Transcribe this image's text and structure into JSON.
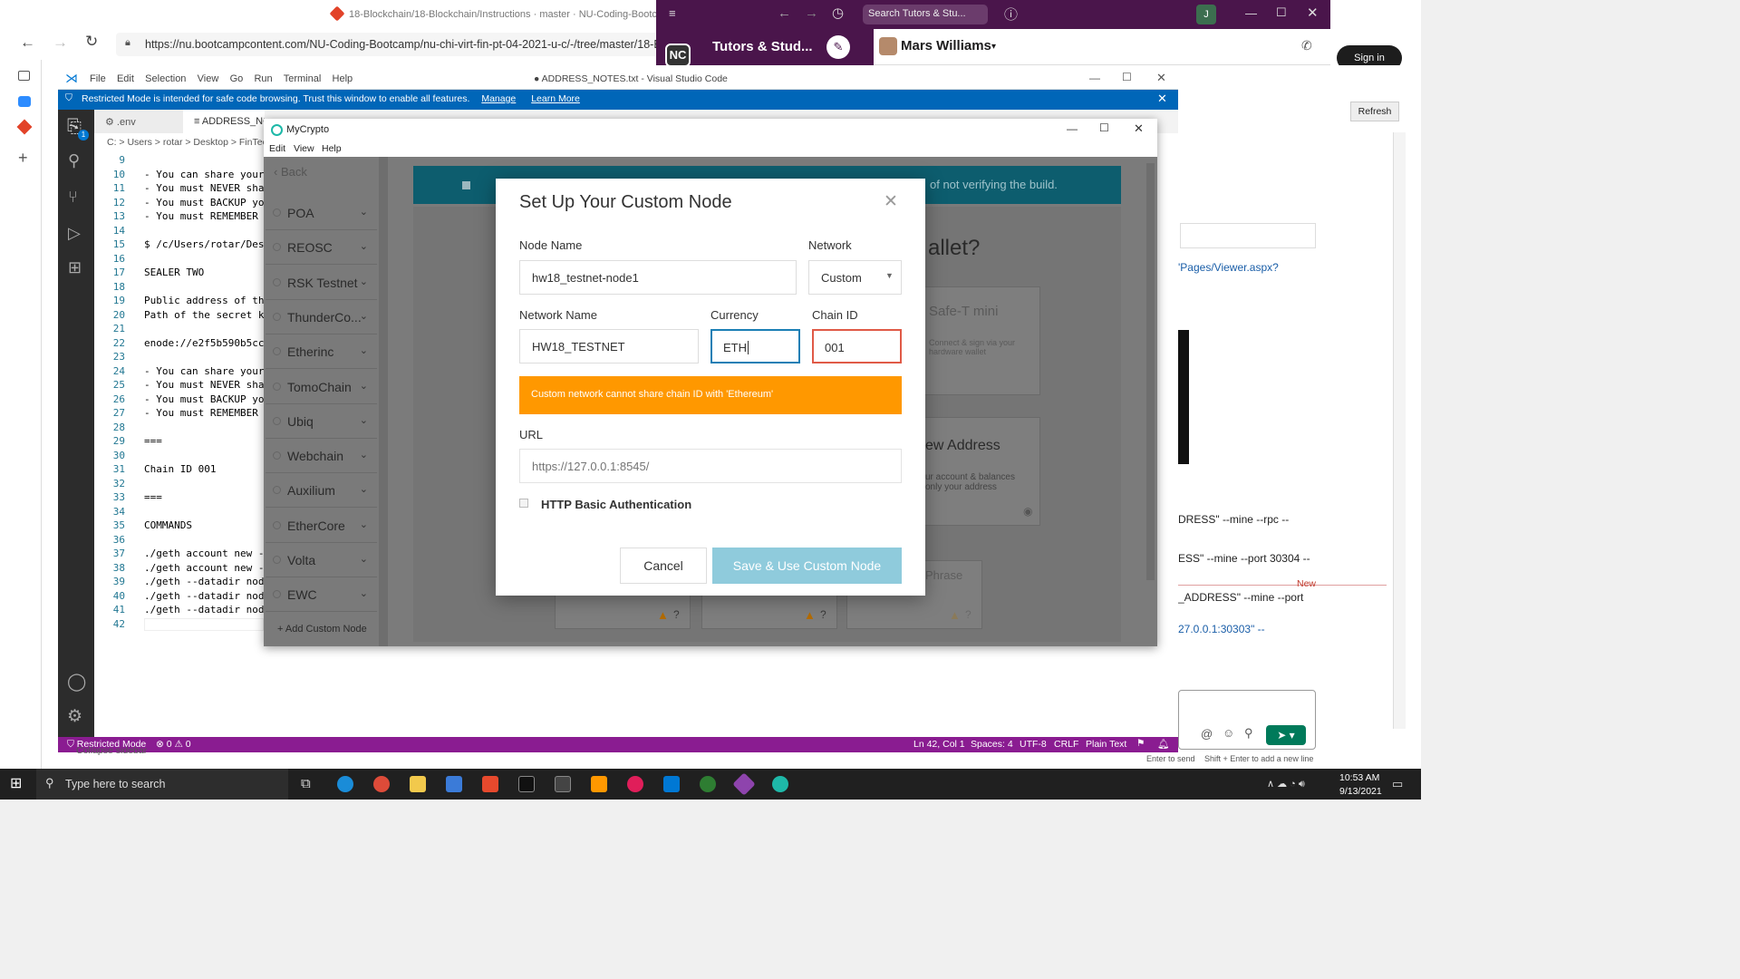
{
  "browser": {
    "tab_title": "18-Blockchain/18-Blockchain/Instructions · master · NU-Coding-Bootcamp / N",
    "url": "https://nu.bootcampcontent.com/NU-Coding-Bootcamp/nu-chi-virt-fin-pt-04-2021-u-c/-/tree/master/18-Block"
  },
  "slack": {
    "search_placeholder": "Search Tutors & Stu...",
    "workspace_initials": "NC",
    "workspace_name": "Tutors & Stud...",
    "user_name": "Mars Williams",
    "signin_label": "Sign in",
    "refresh_label": "Refresh",
    "fragments": {
      "viewer": "'Pages/Viewer.aspx?",
      "mine_rpc": "DRESS\" --mine --rpc --",
      "mine_port": "ESS\" --mine --port 30304 --",
      "new_label": "New",
      "address_mine": "_ADDRESS\" --mine --port",
      "enode_port": "27.0.0.1:30303\" --",
      "enter_hint": "Enter to send",
      "shift_hint": "Shift + Enter to add a new line"
    }
  },
  "vscode": {
    "menu": [
      "File",
      "Edit",
      "Selection",
      "View",
      "Go",
      "Run",
      "Terminal",
      "Help"
    ],
    "window_title": "● ADDRESS_NOTES.txt - Visual Studio Code",
    "banner_text": "Restricted Mode is intended for safe code browsing. Trust this window to enable all features.",
    "banner_manage": "Manage",
    "banner_learn": "Learn More",
    "tabs": [
      ".env",
      "ADDRESS_NO"
    ],
    "breadcrumb": "C: > Users > rotar > Desktop > FinTec",
    "explorer_badge": "1",
    "collapse_sidebar": "Collapse sidebar",
    "lines": [
      {
        "n": "9",
        "t": ""
      },
      {
        "n": "10",
        "t": "- You can share your"
      },
      {
        "n": "11",
        "t": "- You must NEVER shar"
      },
      {
        "n": "12",
        "t": "- You must BACKUP you"
      },
      {
        "n": "13",
        "t": "- You must REMEMBER y"
      },
      {
        "n": "14",
        "t": ""
      },
      {
        "n": "15",
        "t": "$ /c/Users/rotar/Desk"
      },
      {
        "n": "16",
        "t": ""
      },
      {
        "n": "17",
        "t": "SEALER TWO"
      },
      {
        "n": "18",
        "t": ""
      },
      {
        "n": "19",
        "t": "Public address of the"
      },
      {
        "n": "20",
        "t": "Path of the secret ke"
      },
      {
        "n": "21",
        "t": ""
      },
      {
        "n": "22",
        "t": "enode://e2f5b590b5cce"
      },
      {
        "n": "23",
        "t": ""
      },
      {
        "n": "24",
        "t": "- You can share your"
      },
      {
        "n": "25",
        "t": "- You must NEVER shar"
      },
      {
        "n": "26",
        "t": "- You must BACKUP you"
      },
      {
        "n": "27",
        "t": "- You must REMEMBER y"
      },
      {
        "n": "28",
        "t": ""
      },
      {
        "n": "29",
        "t": "==="
      },
      {
        "n": "30",
        "t": ""
      },
      {
        "n": "31",
        "t": "Chain ID 001"
      },
      {
        "n": "32",
        "t": ""
      },
      {
        "n": "33",
        "t": "==="
      },
      {
        "n": "34",
        "t": ""
      },
      {
        "n": "35",
        "t": "COMMANDS"
      },
      {
        "n": "36",
        "t": ""
      },
      {
        "n": "37",
        "t": "./geth account new --"
      },
      {
        "n": "38",
        "t": "./geth account new --"
      },
      {
        "n": "39",
        "t": "./geth --datadir node"
      },
      {
        "n": "40",
        "t": "./geth --datadir node"
      },
      {
        "n": "41",
        "t": "./geth --datadir node"
      },
      {
        "n": "42",
        "t": ""
      }
    ],
    "status": {
      "mode": "Restricted Mode",
      "problems": "⊗ 0 ⚠ 0",
      "position": "Ln 42, Col 1",
      "spaces": "Spaces: 4",
      "encoding": "UTF-8",
      "eol": "CRLF",
      "language": "Plain Text"
    }
  },
  "mycrypto": {
    "title": "MyCrypto",
    "menu": [
      "Edit",
      "View",
      "Help"
    ],
    "back_label": "Back",
    "networks": [
      "POA",
      "REOSC",
      "RSK Testnet",
      "ThunderCo...",
      "Etherinc",
      "TomoChain",
      "Ubiq",
      "Webchain",
      "Auxilium",
      "EtherCore",
      "Volta",
      "EWC"
    ],
    "add_custom_node": "+ Add Custom Node",
    "banner_text": "of not verifying the build.",
    "bg_heading": "allet?",
    "bg_safe_t": "Safe-T mini",
    "bg_safe_t_sub": "Connect & sign via your hardware wallet",
    "bg_view_address": "ew Address",
    "bg_view_sub": "ur account & balances only your address",
    "bg_phrase": "Phrase",
    "modal": {
      "title": "Set Up Your Custom Node",
      "node_name_label": "Node Name",
      "node_name_value": "hw18_testnet-node1",
      "network_label": "Network",
      "network_value": "Custom",
      "network_name_label": "Network Name",
      "network_name_value": "HW18_TESTNET",
      "currency_label": "Currency",
      "currency_value": "ETH",
      "chain_id_label": "Chain ID",
      "chain_id_value": "001",
      "error_text": "Custom network cannot share chain ID with 'Ethereum'",
      "url_label": "URL",
      "url_placeholder": "https://127.0.0.1:8545/",
      "http_auth_label": "HTTP Basic Authentication",
      "cancel_label": "Cancel",
      "save_label": "Save & Use Custom Node"
    }
  },
  "taskbar": {
    "search_placeholder": "Type here to search",
    "time": "10:53 AM",
    "date": "9/13/2021"
  },
  "colors": {
    "error_orange": "#ff9800",
    "save_button": "#8fcbdc",
    "slack_purple": "#4a154b",
    "vscode_status": "#8a1c91",
    "vscode_banner": "#0066b8"
  }
}
